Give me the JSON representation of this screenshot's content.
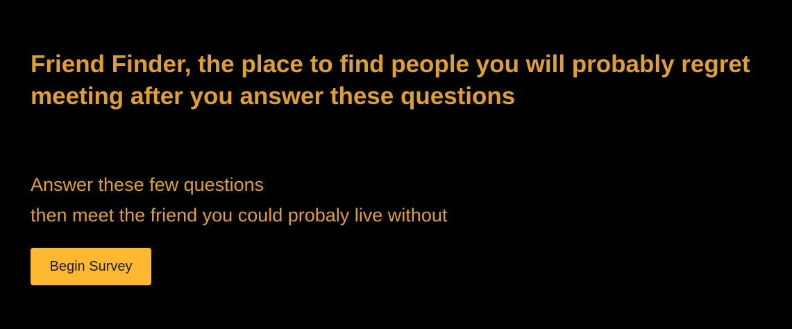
{
  "hero": {
    "headline": "Friend Finder, the place to find people you will probably regret meeting after you answer these questions",
    "intro_line_1": "Answer these few questions",
    "intro_line_2": "then meet the friend you could probaly live without",
    "begin_button_label": "Begin Survey"
  },
  "colors": {
    "background": "#000000",
    "text_accent": "#E0A02C",
    "button_background": "#FFB830",
    "button_text": "#1a1a1a"
  }
}
